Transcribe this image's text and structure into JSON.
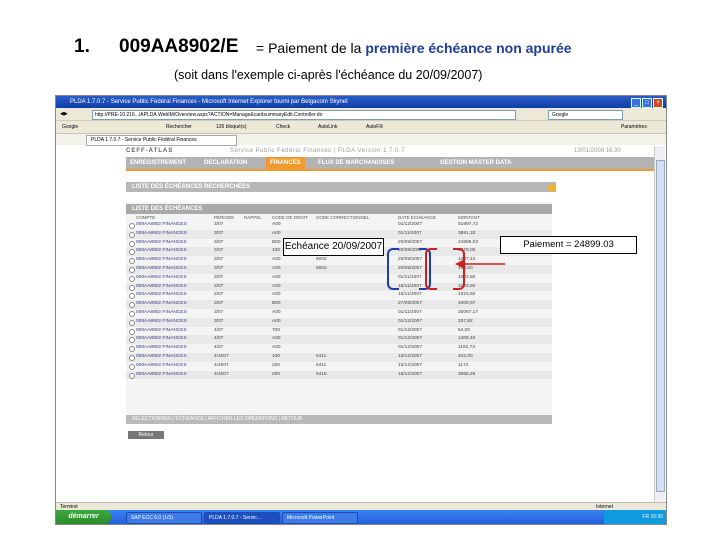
{
  "slide": {
    "number": "1.",
    "code": "009AA8902/E",
    "desc_prefix": "= Paiement de la ",
    "desc_highlight": "première échéance non apurée",
    "subtitle": "(soit dans l'exemple ci-après l'échéance du 20/09/2007)"
  },
  "browser": {
    "title": "PLDA 1.7.0.7 - Service Public Fédéral Finances - Microsoft Internet Explorer fourni par Belgacom Skynet",
    "address": "http://PRE-10.216.../APLDA.WebIM/Overview.aspx?ACTION=Manage&cardsummaryEdit.Controller.do",
    "search_placeholder": "Google",
    "toolbar_items": [
      "Google",
      "Rechercher",
      "126 bloqué(s)",
      "Check",
      "AutoLink",
      "AutoFill",
      "Paramètres"
    ],
    "tab_label": "PLDA 1.7.0.7 - Service Public Fédéral Finances",
    "status_left": "Terminé",
    "status_right": "Internet",
    "icons": {
      "close": "close-icon",
      "minimize": "minimize-icon",
      "maximize": "maximize-icon"
    }
  },
  "app": {
    "logo": "CEFF-ATLAS",
    "title": "Service Public Fédéral Finances | PLDA Version 1.7.0.7",
    "date": "13/01/2008 16:30",
    "nav": [
      "ENREGISTREMENT",
      "DECLARATION",
      "FINANCES",
      "FLUX DE MARCHANDISES",
      "GESTION MASTER DATA"
    ],
    "active_nav": "FINANCES",
    "section_title": "LISTE DES ÉCHÉANCES RECHERCHÉES",
    "panel_title": "LISTE DES ÉCHÉANCES",
    "columns": [
      "COMPTE",
      "PÉRIODE",
      "RAPPEL",
      "CODE DE DROIT",
      "CODE CORRECTIONNEL",
      "DATE ÉCHÉANCE",
      "MONTANT"
    ],
    "rows": [
      [
        "009AA8902 FINANCES",
        "3/07",
        "",
        "A00",
        "",
        "01/12/2007",
        "51997,72"
      ],
      [
        "009AA8902 FINANCES",
        "3/07",
        "",
        "A00",
        "",
        "01/11/2007",
        "3891,33"
      ],
      [
        "009AA8902 FINANCES",
        "3/07",
        "",
        "B00",
        "5001",
        "20/09/2007",
        "24899,03"
      ],
      [
        "009AA8902 FINANCES",
        "3/07",
        "",
        "100",
        "5001",
        "20/09/2007",
        "2376,00"
      ],
      [
        "009AA8902 FINANCES",
        "3/07",
        "",
        "A00",
        "5002",
        "20/09/2007",
        "1007,42"
      ],
      [
        "009AA8902 FINANCES",
        "3/07",
        "",
        "A00",
        "5002",
        "20/09/2007",
        "443,00"
      ],
      [
        "009AA8902 FINANCES",
        "3/07",
        "",
        "A00",
        "",
        "01/11/2007",
        "1023,50"
      ],
      [
        "009AA8902 FINANCES",
        "2/07",
        "",
        "A00",
        "",
        "15/11/2007",
        "1023,50"
      ],
      [
        "009AA8902 FINANCES",
        "2/07",
        "",
        "A00",
        "",
        "15/11/2007",
        "1023,50"
      ],
      [
        "009AA8902 FINANCES",
        "3/07",
        "",
        "B00",
        "",
        "27/09/2007",
        "4009,97"
      ],
      [
        "009AA8902 FINANCES",
        "3/07",
        "",
        "A00",
        "",
        "01/11/2007",
        "20067,17"
      ],
      [
        "009AA8902 FINANCES",
        "3/07",
        "",
        "A00",
        "",
        "01/12/2007",
        "337,82"
      ],
      [
        "009AA8902 FINANCES",
        "4/07",
        "",
        "700",
        "",
        "01/12/2007",
        "54,00"
      ],
      [
        "009AA8902 FINANCES",
        "4/07",
        "",
        "A00",
        "",
        "01/12/2007",
        "1409,40"
      ],
      [
        "009AA8902 FINANCES",
        "4/07",
        "",
        "A00",
        "",
        "01/12/2007",
        "1162,73"
      ],
      [
        "009AA8902 FINANCES",
        "4/4007",
        "",
        "100",
        "5411",
        "15/12/2007",
        "442,00"
      ],
      [
        "009AA8902 FINANCES",
        "4/4007",
        "",
        "200",
        "5411",
        "15/12/2007",
        "1172"
      ],
      [
        "009AA8902 FINANCES",
        "4/4007",
        "",
        "200",
        "5415",
        "15/12/2007",
        "3068,26"
      ]
    ],
    "bottom_bar": "SÉLECTIONNER L'ÉCHÉANCE | AFFICHER LES OPÉRATIONS | RETOUR",
    "back_button": "Retour"
  },
  "callouts": {
    "echeance": "Echéance 20/09/2007",
    "paiement": "Paiement = 24899.03",
    "bracket_color": "#1f3da8",
    "red_color": "#cc1f1f"
  },
  "taskbar": {
    "start": "démarrer",
    "buttons": [
      "SAP ECC 6.0 (1/3)",
      "PLDA 1.7.0.7 - Servic...",
      "Microsoft PowerPoint"
    ],
    "tray": "FR 16:30"
  }
}
